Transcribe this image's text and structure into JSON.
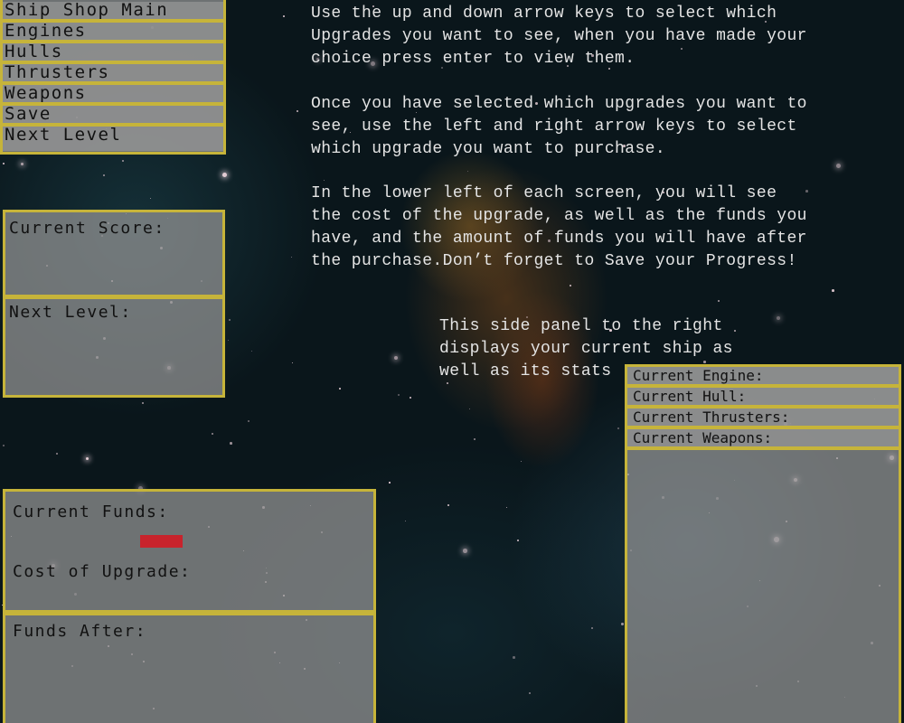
{
  "menu": {
    "items": [
      "Ship Shop Main",
      "Engines",
      "Hulls",
      "Thrusters",
      "Weapons",
      "Save",
      "Next Level"
    ]
  },
  "score_panel": {
    "current_score_label": "Current Score:",
    "next_level_label": "Next Level:"
  },
  "instructions": {
    "paragraph1": "Use the up and down arrow keys to select which\nUpgrades you want to see, when you have made your\nchoice press enter to view them.",
    "paragraph2": "Once you have selected which upgrades you want to\nsee, use the left and right arrow keys to select\nwhich upgrade you want to purchase.",
    "paragraph3": "In the lower left of each screen, you will see\nthe cost of the upgrade, as well as the funds you\nhave, and the amount of funds you will have after\nthe purchase.Don’t forget to Save your Progress!",
    "side_note": "This side panel to the right\ndisplays your current ship as\nwell as its stats"
  },
  "funds_panel": {
    "current_funds_label": "Current Funds:",
    "cost_label": "Cost of Upgrade:",
    "funds_after_label": "Funds After:",
    "indicator_color": "#c8232c"
  },
  "ship_panel": {
    "rows": [
      "Current Engine:",
      "Current Hull:",
      "Current Thrusters:",
      "Current Weapons:"
    ]
  },
  "colors": {
    "accent": "#c6b43a",
    "panel": "#969696"
  }
}
